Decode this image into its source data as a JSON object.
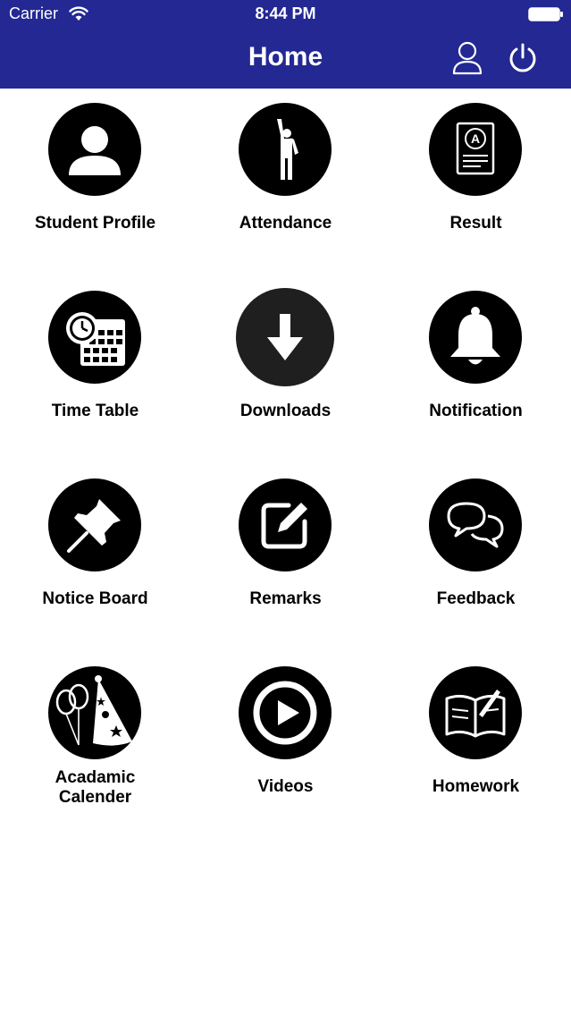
{
  "status_bar": {
    "carrier": "Carrier",
    "time": "8:44 PM"
  },
  "nav": {
    "title": "Home",
    "profile_icon": "user-outline-icon",
    "power_icon": "power-icon"
  },
  "colors": {
    "header_bg": "#232892",
    "tile_circle": "#000000",
    "text": "#000000"
  },
  "tiles": [
    {
      "label": "Student Profile",
      "icon": "user-icon"
    },
    {
      "label": "Attendance",
      "icon": "person-raising-hand-icon"
    },
    {
      "label": "Result",
      "icon": "report-card-icon"
    },
    {
      "label": "Time Table",
      "icon": "clock-calendar-icon"
    },
    {
      "label": "Downloads",
      "icon": "download-arrow-icon"
    },
    {
      "label": "Notification",
      "icon": "bell-icon"
    },
    {
      "label": "Notice Board",
      "icon": "pushpin-icon"
    },
    {
      "label": "Remarks",
      "icon": "edit-icon"
    },
    {
      "label": "Feedback",
      "icon": "chat-bubbles-icon"
    },
    {
      "label": "Acadamic\nCalender",
      "icon": "party-balloons-icon"
    },
    {
      "label": "Videos",
      "icon": "play-circle-icon"
    },
    {
      "label": "Homework",
      "icon": "open-book-pencil-icon"
    }
  ]
}
